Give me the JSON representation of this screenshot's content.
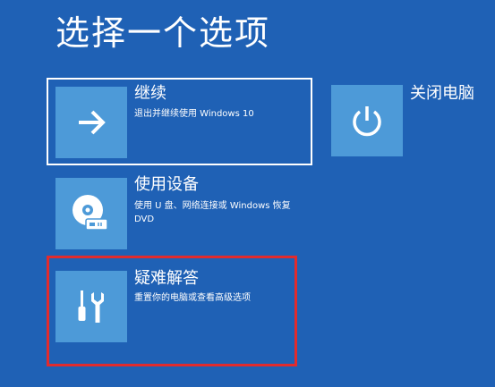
{
  "page": {
    "title": "选择一个选项",
    "background_color": "#1f61b5",
    "tile_color": "#4d9ad8",
    "highlight_color": "#e12b2e"
  },
  "options": {
    "continue": {
      "label": "继续",
      "description": "退出并继续使用 Windows 10",
      "icon": "arrow-right-icon"
    },
    "use_device": {
      "label": "使用设备",
      "description": "使用 U 盘、网络连接或 Windows 恢复 DVD",
      "icon": "disc-drive-icon"
    },
    "troubleshoot": {
      "label": "疑难解答",
      "description": "重置你的电脑或查看高级选项",
      "icon": "screwdriver-wrench-icon"
    },
    "shutdown": {
      "label": "关闭电脑",
      "icon": "power-icon"
    }
  }
}
